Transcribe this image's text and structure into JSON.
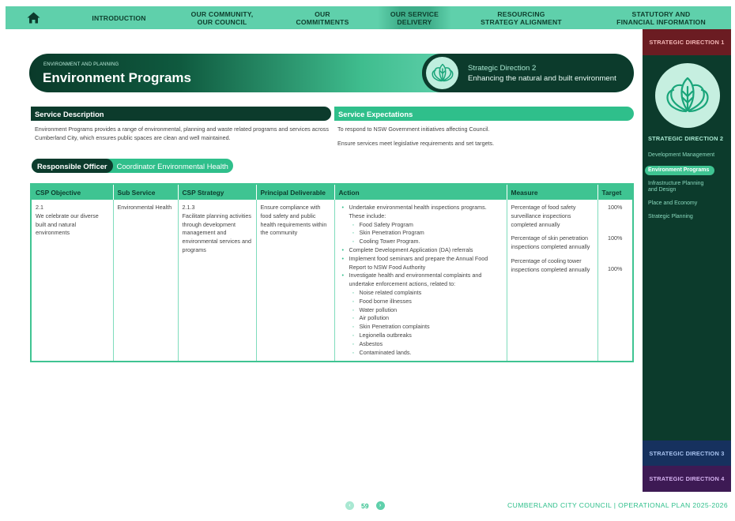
{
  "nav": {
    "items": [
      {
        "label": "INTRODUCTION"
      },
      {
        "label": "OUR COMMUNITY,\nOUR COUNCIL"
      },
      {
        "label": "OUR\nCOMMITMENTS"
      },
      {
        "label": "OUR SERVICE\nDELIVERY"
      },
      {
        "label": "RESOURCING\nSTRATEGY ALIGNMENT"
      },
      {
        "label": "STATUTORY AND\nFINANCIAL INFORMATION"
      }
    ],
    "active_index": 3
  },
  "sidebar": {
    "sd1": "STRATEGIC DIRECTION 1",
    "sd2": "STRATEGIC DIRECTION 2",
    "links": [
      {
        "label": "Development Management"
      },
      {
        "label": "Environment Programs"
      },
      {
        "label": "Infrastructure Planning and Design"
      },
      {
        "label": "Place and Economy"
      },
      {
        "label": "Strategic Planning"
      }
    ],
    "sd3": "STRATEGIC DIRECTION 3",
    "sd4": "STRATEGIC DIRECTION 4"
  },
  "banner": {
    "eyebrow": "ENVIRONMENT AND PLANNING",
    "title": "Environment Programs",
    "sd_name": "Strategic Direction 2",
    "sd_sub": "Enhancing the natural and built environment"
  },
  "service": {
    "desc_header": "Service Description",
    "desc_text": "Environment Programs provides a range of environmental, planning and waste related programs and services across Cumberland City, which ensures public spaces are clean and well maintained.",
    "exp_header": "Service Expectations",
    "exp_line1": "To respond to NSW Government initiatives affecting Council.",
    "exp_line2": "Ensure services meet legislative requirements and set targets."
  },
  "officer": {
    "label": "Responsible Officer",
    "value": "Coordinator Environmental Health"
  },
  "table": {
    "headers": [
      "CSP Objective",
      "Sub Service",
      "CSP Strategy",
      "Principal Deliverable",
      "Action",
      "Measure",
      "Target"
    ],
    "row": {
      "objective_num": "2.1",
      "objective_text": "We celebrate our diverse built and natural environments",
      "sub_service": "Environmental Health",
      "strategy_num": "2.1.3",
      "strategy_text": "Facilitate planning activities through development management and environmental services and programs",
      "deliverable": "Ensure compliance with food safety and public health requirements within the community",
      "actions": [
        {
          "level": 1,
          "text": "Undertake environmental health inspections programs. These include:"
        },
        {
          "level": 2,
          "text": "Food Safety Program"
        },
        {
          "level": 2,
          "text": "Skin Penetration Program"
        },
        {
          "level": 2,
          "text": "Cooling Tower Program."
        },
        {
          "level": 1,
          "text": "Complete Development Application (DA) referrals"
        },
        {
          "level": 1,
          "text": "Implement food seminars and prepare the Annual Food Report to NSW Food Authority"
        },
        {
          "level": 1,
          "text": "Investigate health and environmental complaints and undertake enforcement actions, related to:"
        },
        {
          "level": 2,
          "text": "Noise related complaints"
        },
        {
          "level": 2,
          "text": "Food borne illnesses"
        },
        {
          "level": 2,
          "text": "Water pollution"
        },
        {
          "level": 2,
          "text": "Air pollution"
        },
        {
          "level": 2,
          "text": "Skin Penetration complaints"
        },
        {
          "level": 2,
          "text": "Legionella outbreaks"
        },
        {
          "level": 2,
          "text": "Asbestos"
        },
        {
          "level": 2,
          "text": "Contaminated lands."
        }
      ],
      "measures": [
        "Percentage of food safety surveillance inspections completed annually",
        "Percentage of skin penetration inspections completed annually",
        "Percentage of cooling tower inspections completed annually"
      ],
      "targets": [
        "100%",
        "100%",
        "100%"
      ]
    }
  },
  "footer": {
    "page_number": "59",
    "org": "CUMBERLAND CITY COUNCIL",
    "sep": "|",
    "doc": "OPERATIONAL PLAN 2025-2026"
  },
  "colors": {
    "nav_green": "#5fd0ab",
    "dark_green": "#0c3b2c",
    "accent_green": "#2fbf8b",
    "sd1": "#6b1c22",
    "sd3": "#16315e",
    "sd4": "#3d1a54"
  }
}
